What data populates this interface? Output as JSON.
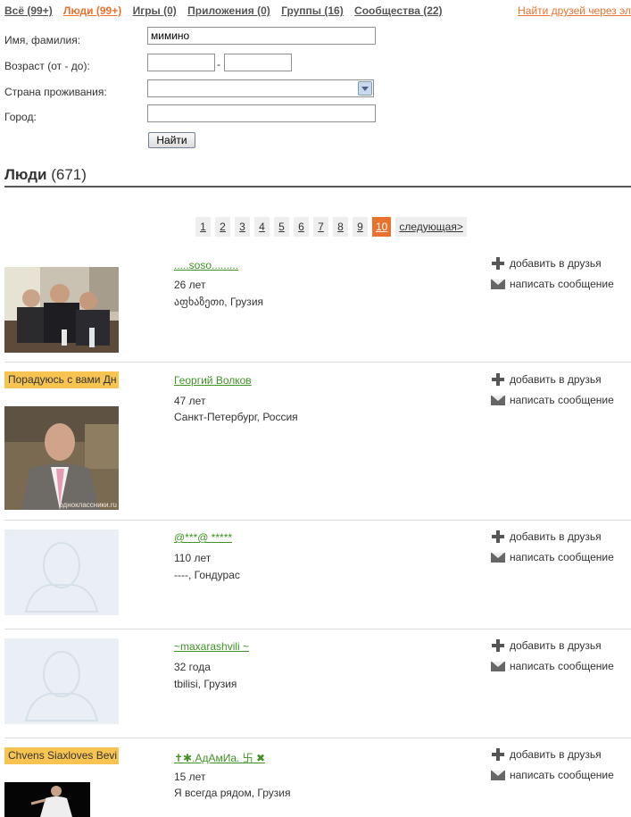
{
  "nav": {
    "tabs": [
      {
        "label": "Всё (99+)",
        "active": false
      },
      {
        "label": "Люди (99+)",
        "active": true
      },
      {
        "label": "Игры (0)",
        "active": false
      },
      {
        "label": "Приложения (0)",
        "active": false
      },
      {
        "label": "Группы (16)",
        "active": false
      },
      {
        "label": "Сообщества (22)",
        "active": false
      }
    ],
    "find_friends": "Найти друзей через эл"
  },
  "form": {
    "name_label": "Имя, фамилия:",
    "name_value": "мимино",
    "age_label": "Возраст (от - до):",
    "age_dash": "-",
    "country_label": "Страна проживания:",
    "city_label": "Город:",
    "search_button": "Найти"
  },
  "section": {
    "title": "Люди",
    "count": "(671)"
  },
  "pager": {
    "pages": [
      "1",
      "2",
      "3",
      "4",
      "5",
      "6",
      "7",
      "8",
      "9",
      "10"
    ],
    "current": "10",
    "next": "следующая>"
  },
  "actions": {
    "add_friend": "добавить в друзья",
    "send_message": "написать сообщение"
  },
  "results": [
    {
      "name": ".....soso.........",
      "age": "26 лет",
      "location": "აფხაზეთი, Грузия",
      "status": "",
      "photo": "group-photo"
    },
    {
      "name": "Георгий Волков",
      "age": "47 лет",
      "location": "Санкт-Петербург, Россия",
      "status": "Порадуюсь с вами Дн",
      "photo": "portrait-photo",
      "watermark": "одноклассники.ru"
    },
    {
      "name": "@***@ *****",
      "age": "110 лет",
      "location": "----, Гондурас",
      "status": "",
      "photo": "placeholder"
    },
    {
      "name": "~maxarashvili ~",
      "age": "32 года",
      "location": "tbilisi, Грузия",
      "status": "",
      "photo": "placeholder"
    },
    {
      "name": "✝✱.АдАмИа. 卐 ✖",
      "age": "15 лет",
      "location": "Я всегда рядом, Грузия",
      "status": "Chvens Siaxloves Bevi",
      "photo": "dark-photo"
    }
  ],
  "colors": {
    "accent_orange": "#eb722e",
    "link_green": "#3f9223",
    "status_tag": "#f7c451"
  }
}
